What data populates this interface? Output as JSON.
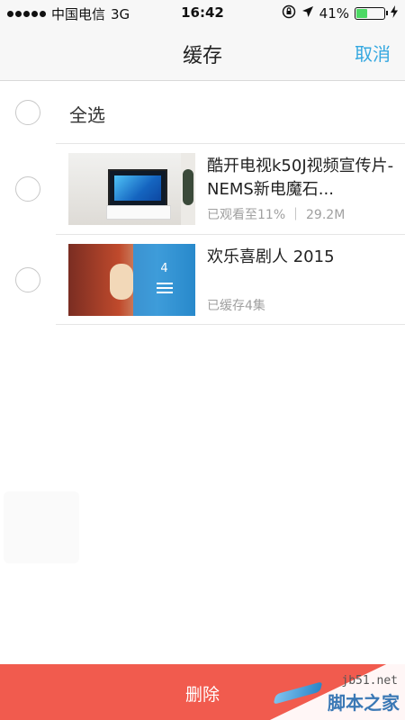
{
  "status_bar": {
    "carrier": "中国电信",
    "network": "3G",
    "time": "16:42",
    "battery_percent": "41%",
    "battery_level": 0.41,
    "icons": [
      "signal-dots-icon",
      "orientation-lock-icon",
      "location-arrow-icon",
      "battery-icon",
      "charging-bolt-icon"
    ]
  },
  "nav": {
    "title": "缓存",
    "cancel_label": "取消"
  },
  "select_all_label": "全选",
  "items": [
    {
      "title": "酷开电视k50J视频宣传片-NEMS新电魔石...",
      "meta": "已观看至11% ｜ 29.2M",
      "thumbnail": "tv-living-room-thumbnail"
    },
    {
      "title": "欢乐喜剧人 2015",
      "meta": "已缓存4集",
      "thumbnail": "comedy-opera-thumbnail",
      "episode_count": "4"
    }
  ],
  "delete_label": "删除",
  "watermark": {
    "url": "jb51.net",
    "name": "脚本之家"
  },
  "colors": {
    "accent": "#35a8e0",
    "delete_bar": "#f15b4e",
    "battery_fill": "#4cd964"
  }
}
